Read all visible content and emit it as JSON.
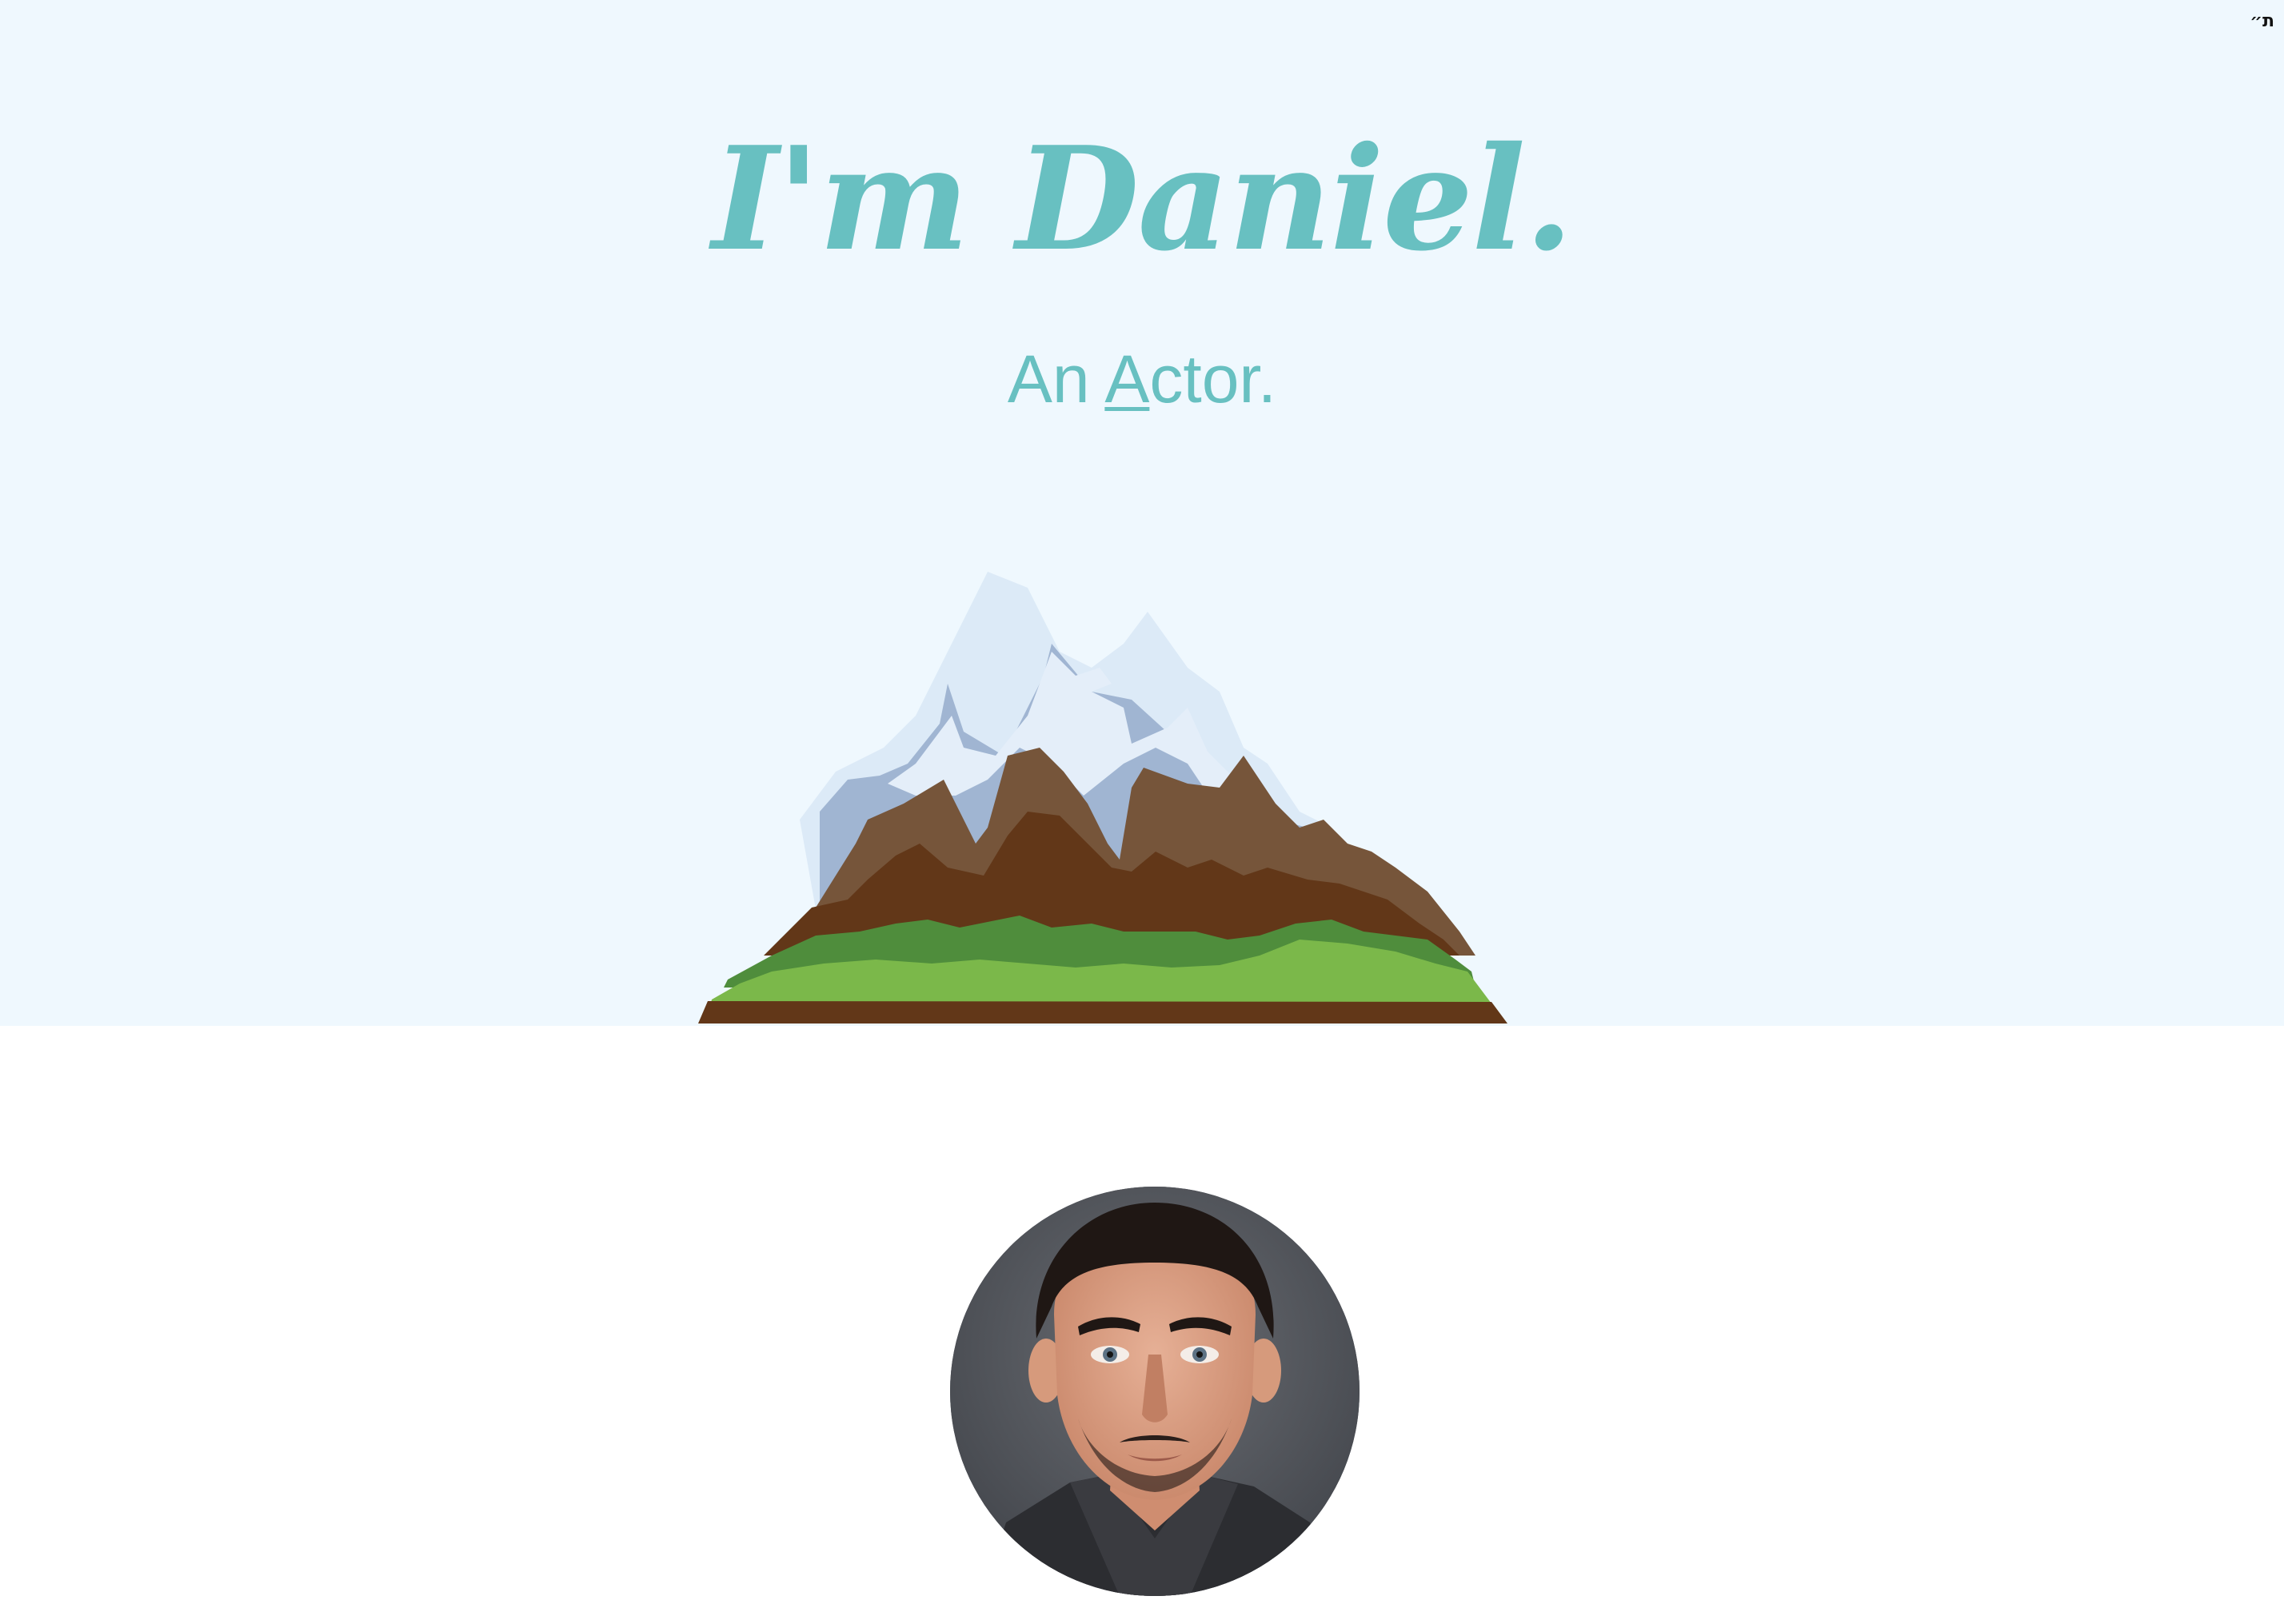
{
  "top_bar": {
    "language_link": "ת״"
  },
  "hero": {
    "title": "I'm Daniel.",
    "subtitle_prefix": "An ",
    "subtitle_accent": "A",
    "subtitle_rest": "ctor.",
    "background_color": "#eff8fe",
    "accent_color": "#68c0c1"
  },
  "illustration": {
    "icon": "mountain-illustration"
  },
  "profile": {
    "photo": "profile-photo-avatar"
  }
}
